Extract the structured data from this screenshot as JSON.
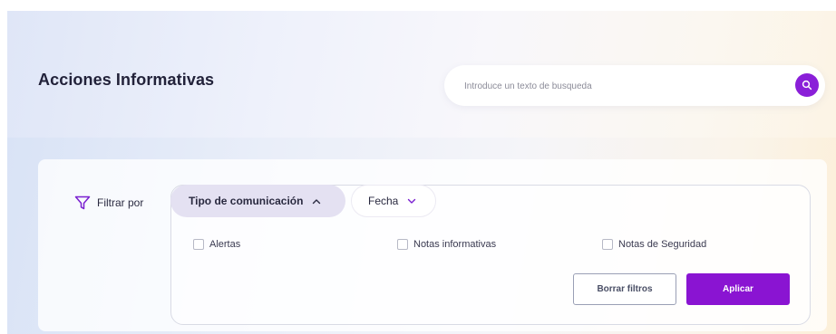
{
  "header": {
    "title": "Acciones Informativas"
  },
  "search": {
    "placeholder": "Introduce un texto de busqueda",
    "button_icon": "search-icon"
  },
  "filters": {
    "label": "Filtrar por",
    "icon": "filter-icon",
    "tabs": [
      {
        "label": "Tipo de comunicación",
        "expanded": true,
        "icon": "chevron-up-icon"
      },
      {
        "label": "Fecha",
        "expanded": false,
        "icon": "chevron-down-icon"
      }
    ],
    "options": [
      {
        "label": "Alertas",
        "checked": false
      },
      {
        "label": "Notas informativas",
        "checked": false
      },
      {
        "label": "Notas de Seguridad",
        "checked": false
      }
    ],
    "clear_label": "Borrar filtros",
    "apply_label": "Aplicar"
  },
  "colors": {
    "accent": "#8a14d2",
    "title_text": "#22223a",
    "active_tab_bg": "#e4e1f2"
  }
}
